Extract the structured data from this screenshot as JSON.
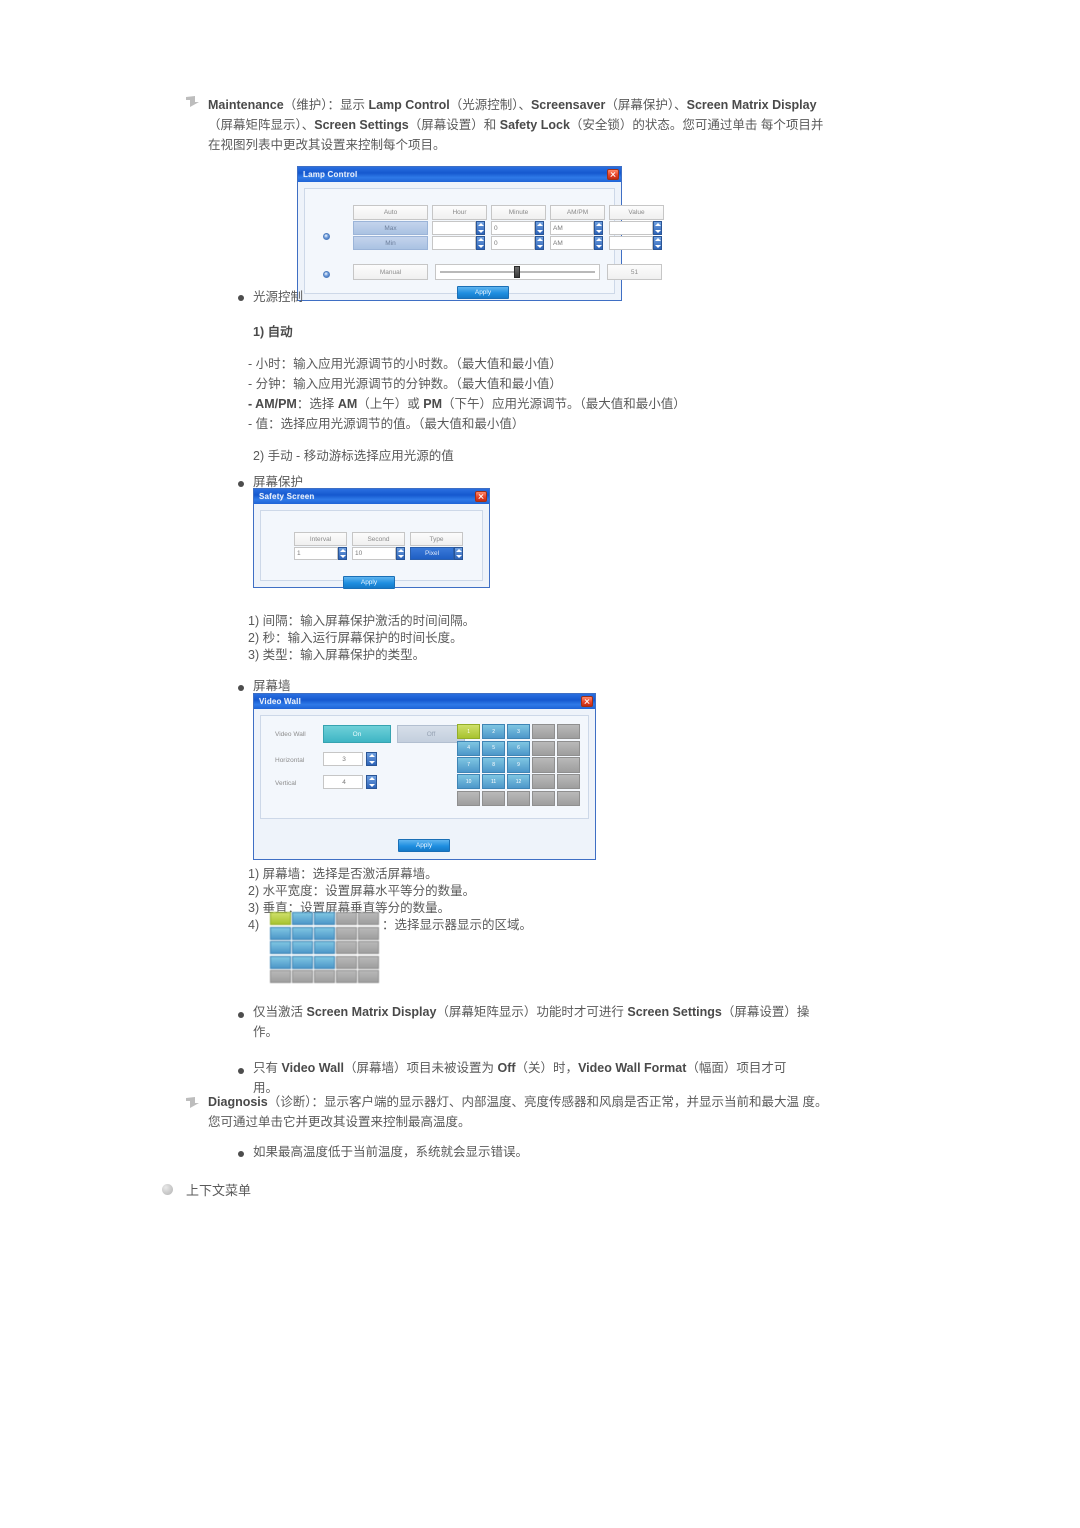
{
  "page": {
    "background": "#ffffff",
    "text_color": "#5a5a5a"
  },
  "sections": {
    "maintenance": {
      "bullet": "flag-bullet-icon",
      "line1_a": "Maintenance",
      "line1_b": "（维护）：显示 ",
      "line1_c": "Lamp Control",
      "line1_d": "（光源控制）、",
      "line1_e": "Screensaver",
      "line1_f": "（屏幕保护）、",
      "line1_g": "Screen Matrix",
      "line2_a": "Display",
      "line2_b": "（屏幕矩阵显示）、",
      "line2_c": "Screen Settings",
      "line2_d": "（屏幕设置）和 ",
      "line2_e": "Safety Lock",
      "line2_f": "（安全锁）的状态。您可通过单击",
      "line3": "每个项目并在视图列表中更改其设置来控制每个项目。"
    },
    "lamp_control_label": "光源控制",
    "lamp_control_items": {
      "auto_title": "1) 自动",
      "hour": "- 小时：输入应用光源调节的小时数。（最大值和最小值）",
      "minute": "- 分钟：输入应用光源调节的分钟数。（最大值和最小值）",
      "ampm_a": "- AM/PM",
      "ampm_b": "：选择 ",
      "ampm_c": "AM",
      "ampm_d": "（上午）或 ",
      "ampm_e": "PM",
      "ampm_f": "（下午）应用光源调节。（最大值和最小值）",
      "value_a": "- 值",
      "value_b": "：选择应用光源调节的值。（最大值和最小值）",
      "manual": "2) 手动 - 移动游标选择应用光源的值"
    },
    "screensaver_label": "屏幕保护",
    "screensaver_items": [
      "1) 间隔：输入屏幕保护激活的时间间隔。",
      "2) 秒：输入运行屏幕保护的时间长度。",
      "3) 类型：输入屏幕保护的类型。"
    ],
    "videowall_label": "屏幕墙",
    "videowall_items": {
      "i1": "1) 屏幕墙：选择是否激活屏幕墙。",
      "i2": "2) 水平宽度：设置屏幕水平等分的数量。",
      "i3": "3) 垂直：设置屏幕垂直等分的数量。",
      "i4_num": "4)",
      "i4_tail": "：选择显示器显示的区域。"
    },
    "notes": {
      "note1_a": "仅当激活 ",
      "note1_b": "Screen Matrix Display",
      "note1_c": "（屏幕矩阵显示）功能时才可进行 ",
      "note1_d": "Screen Settings",
      "note1_e": "（屏幕设置）操",
      "note1_f": "作。",
      "note2_a": "只有 ",
      "note2_b": "Video Wall",
      "note2_c": "（屏幕墙）项目未被设置为 ",
      "note2_d": "Off",
      "note2_e": "（关）时，",
      "note2_f": "Video Wall Format",
      "note2_g": "（幅面）项目才可",
      "note2_h": "用。"
    },
    "diagnosis": {
      "line1_a": "Diagnosis",
      "line1_b": "（诊断）：显示客户端的显示器灯、内部温度、亮度传感器和风扇是否正常，并显示当前和最大温",
      "line2": "度。您可通过单击它并更改其设置来控制最高温度。",
      "note": "如果最高温度低于当前温度，系统就会显示错误。"
    },
    "context_menu_label": "上下文菜单"
  },
  "dialogs": {
    "lamp_control": {
      "title": "Lamp Control",
      "close_icon": "close-icon",
      "columns": [
        "Auto",
        "Hour",
        "Minute",
        "AM/PM",
        "Value"
      ],
      "rows": [
        "Max",
        "Min"
      ],
      "hour_values": [
        "",
        ""
      ],
      "minute_values": [
        "0",
        "0"
      ],
      "ampm_values": [
        "AM",
        "AM"
      ],
      "value_values": [
        "",
        ""
      ],
      "manual_label": "Manual",
      "manual_value": "51",
      "apply_label": "Apply"
    },
    "safety_screen": {
      "title": "Safety Screen",
      "close_icon": "close-icon",
      "columns": [
        "Interval",
        "Second",
        "Type"
      ],
      "interval_value": "1",
      "second_value": "10",
      "type_value": "Pixel",
      "apply_label": "Apply"
    },
    "video_wall": {
      "title": "Video Wall",
      "close_icon": "close-icon",
      "label": "Video Wall",
      "on_label": "On",
      "off_label": "Off",
      "horizontal_label": "Horizontal",
      "horizontal_value": "3",
      "vertical_label": "Vertical",
      "vertical_value": "4",
      "apply_label": "Apply",
      "grid": {
        "cols": 5,
        "rows": 5,
        "active_cols": 3,
        "active_rows": 4,
        "selected": 1,
        "cells": [
          [
            "1",
            "2",
            "3",
            "",
            ""
          ],
          [
            "4",
            "5",
            "6",
            "",
            ""
          ],
          [
            "7",
            "8",
            "9",
            "",
            ""
          ],
          [
            "10",
            "11",
            "12",
            "",
            ""
          ],
          [
            "",
            "",
            "",
            "",
            ""
          ]
        ]
      }
    }
  }
}
